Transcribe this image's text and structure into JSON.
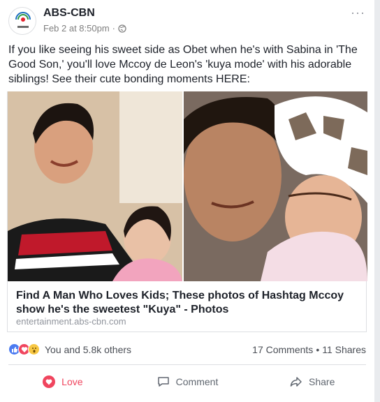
{
  "post": {
    "page_name": "ABS-CBN",
    "timestamp": "Feb 2 at 8:50pm",
    "separator": "·",
    "text": "If you like seeing his sweet side as Obet when he's with Sabina in 'The Good Son,' you'll love Mccoy de Leon's 'kuya mode' with his adorable siblings! See their cute bonding moments HERE:",
    "more_label": "···"
  },
  "link": {
    "title": "Find A Man Who Loves Kids; These photos of Hashtag Mccoy show he's the sweetest \"Kuya\" - Photos",
    "domain": "entertainment.abs-cbn.com"
  },
  "reactions": {
    "summary": "You and 5.8k others",
    "comments": "17 Comments",
    "dot": "•",
    "shares": "11 Shares"
  },
  "actions": {
    "love": "Love",
    "comment": "Comment",
    "share": "Share"
  },
  "colors": {
    "love": "#f0455e",
    "like": "#4b7bf1",
    "muted": "#90949c"
  }
}
